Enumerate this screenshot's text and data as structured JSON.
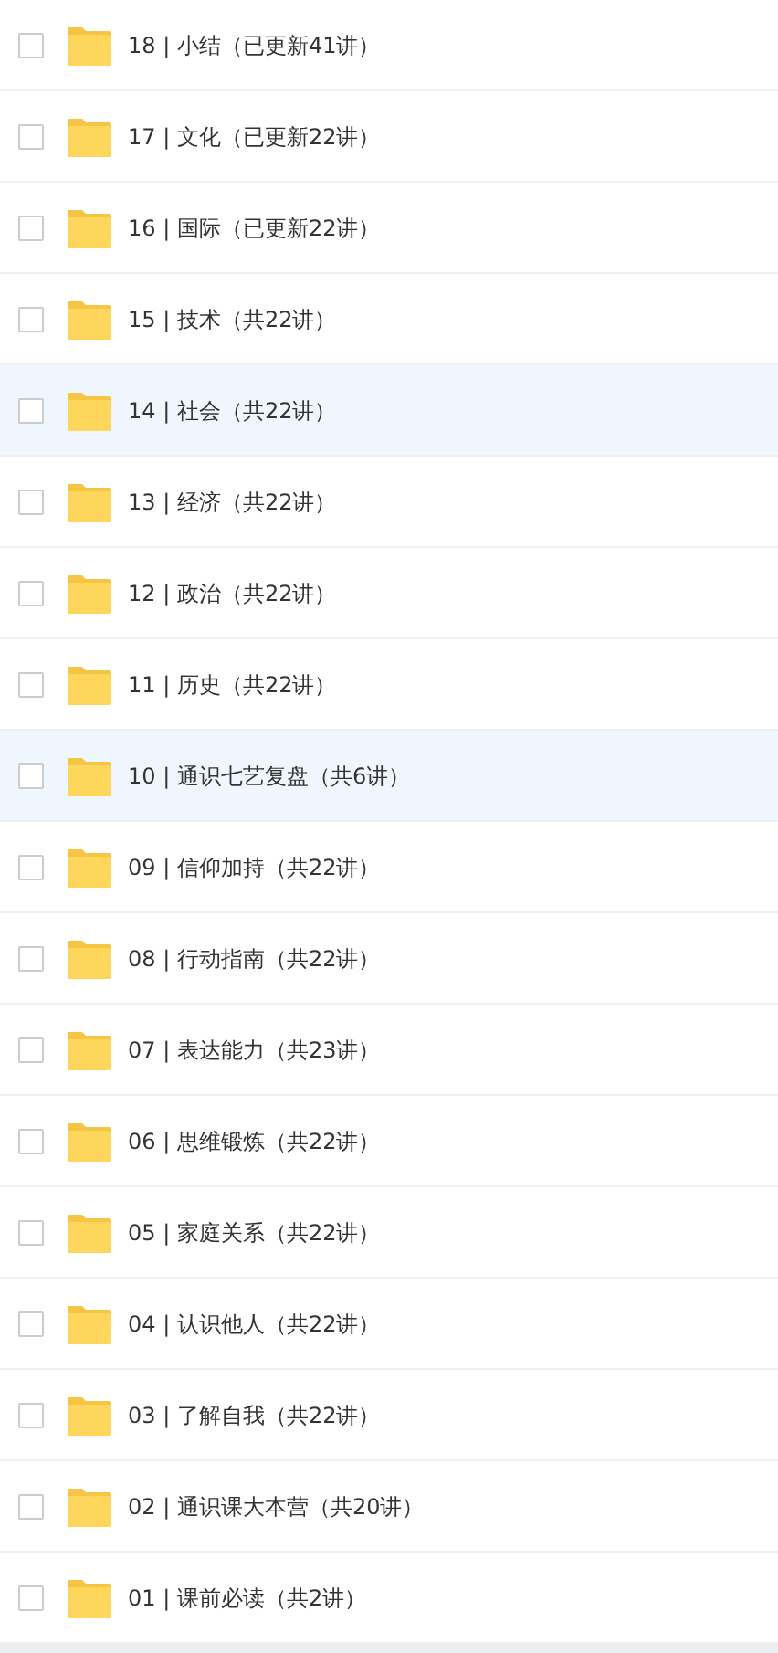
{
  "folders": [
    {
      "label": "18 | 小结（已更新41讲）",
      "checked": false,
      "highlighted": false
    },
    {
      "label": "17 | 文化（已更新22讲）",
      "checked": false,
      "highlighted": false
    },
    {
      "label": "16 | 国际（已更新22讲）",
      "checked": false,
      "highlighted": false
    },
    {
      "label": "15 | 技术（共22讲）",
      "checked": false,
      "highlighted": false
    },
    {
      "label": "14 | 社会（共22讲）",
      "checked": false,
      "highlighted": true
    },
    {
      "label": "13 | 经济（共22讲）",
      "checked": false,
      "highlighted": false
    },
    {
      "label": "12 | 政治（共22讲）",
      "checked": false,
      "highlighted": false
    },
    {
      "label": "11 | 历史（共22讲）",
      "checked": false,
      "highlighted": false
    },
    {
      "label": "10 | 通识七艺复盘（共6讲）",
      "checked": false,
      "highlighted": true
    },
    {
      "label": "09 | 信仰加持（共22讲）",
      "checked": false,
      "highlighted": false
    },
    {
      "label": "08 | 行动指南（共22讲）",
      "checked": false,
      "highlighted": false
    },
    {
      "label": "07 | 表达能力（共23讲）",
      "checked": false,
      "highlighted": false
    },
    {
      "label": "06 | 思维锻炼（共22讲）",
      "checked": false,
      "highlighted": false
    },
    {
      "label": "05 | 家庭关系（共22讲）",
      "checked": false,
      "highlighted": false
    },
    {
      "label": "04 | 认识他人（共22讲）",
      "checked": false,
      "highlighted": false
    },
    {
      "label": "03 | 了解自我（共22讲）",
      "checked": false,
      "highlighted": false
    },
    {
      "label": "02 | 通识课大本营（共20讲）",
      "checked": false,
      "highlighted": false
    },
    {
      "label": "01 | 课前必读（共2讲）",
      "checked": false,
      "highlighted": false
    }
  ]
}
